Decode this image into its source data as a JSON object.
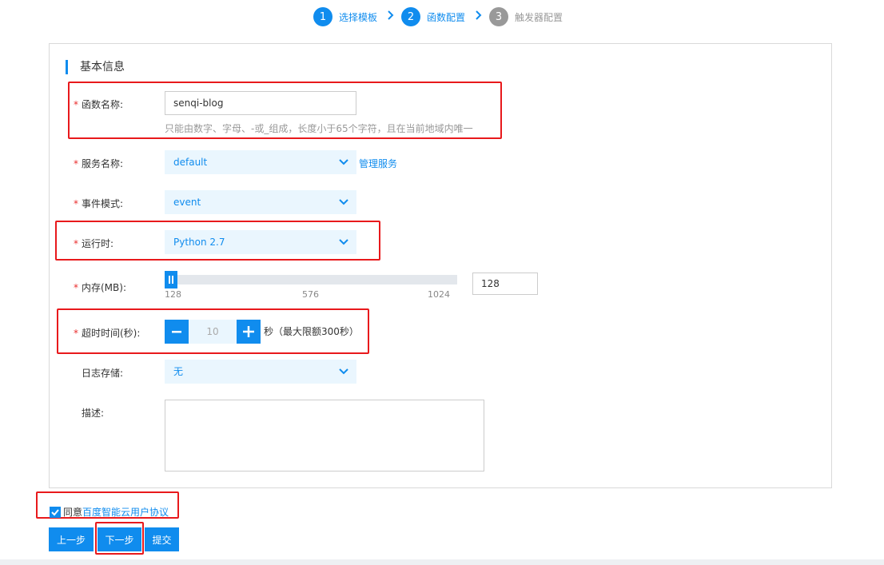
{
  "stepper": {
    "steps": [
      {
        "num": "1",
        "label": "选择模板"
      },
      {
        "num": "2",
        "label": "函数配置"
      },
      {
        "num": "3",
        "label": "触发器配置"
      }
    ]
  },
  "section": {
    "title": "基本信息"
  },
  "form": {
    "function_name": {
      "label": "函数名称:",
      "value": "senqi-blog",
      "hint": "只能由数字、字母、-或_组成，长度小于65个字符，且在当前地域内唯一"
    },
    "service_name": {
      "label": "服务名称:",
      "value": "default",
      "manage_link": "管理服务"
    },
    "event_mode": {
      "label": "事件模式:",
      "value": "event"
    },
    "runtime": {
      "label": "运行时:",
      "value": "Python 2.7"
    },
    "memory": {
      "label": "内存(MB):",
      "value": "128",
      "ticks": [
        "128",
        "576",
        "1024"
      ],
      "level_fraction": 0
    },
    "timeout": {
      "label": "超时时间(秒):",
      "value": "10",
      "minus": "−",
      "plus": "+",
      "note": "秒（最大限额300秒）"
    },
    "log_storage": {
      "label": "日志存储:",
      "value": "无"
    },
    "description": {
      "label": "描述:"
    }
  },
  "agreement": {
    "prefix": "同意",
    "link": "百度智能云用户协议",
    "checked": true
  },
  "buttons": {
    "prev": "上一步",
    "next": "下一步",
    "submit": "提交"
  },
  "colors": {
    "accent": "#108cee",
    "highlight": "#e8191c",
    "select_bg": "#eaf6fe"
  }
}
